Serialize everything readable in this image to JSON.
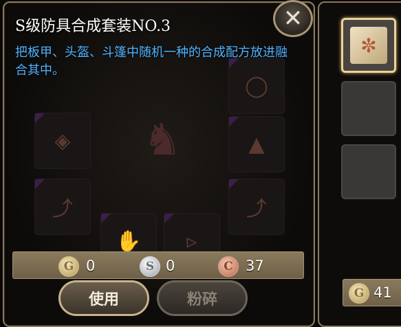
{
  "item_tooltip": {
    "title": "S级防具合成套装NO.3",
    "description": "把板甲、头盔、斗篷中随机一种的合成配方放进融合其中。",
    "close_icon": "close-icon"
  },
  "currency": {
    "gold": {
      "glyph": "G",
      "amount": "0"
    },
    "silver": {
      "glyph": "S",
      "amount": "0"
    },
    "copper": {
      "glyph": "C",
      "amount": "37"
    }
  },
  "actions": {
    "use_label": "使用",
    "crush_label": "粉碎"
  },
  "side_panel": {
    "slots": [
      {
        "icon": "recipe-scroll-icon",
        "selected": true
      },
      {
        "icon": "empty-slot",
        "selected": false
      },
      {
        "icon": "empty-slot",
        "selected": false
      }
    ],
    "coin_glyph": "G",
    "gold_amount": "41"
  },
  "colors": {
    "description_text": "#4fb3ff",
    "panel_border": "#8a7a5e",
    "currency_bar": "#7a6c52",
    "selected_slot_border": "#e9d49a"
  }
}
